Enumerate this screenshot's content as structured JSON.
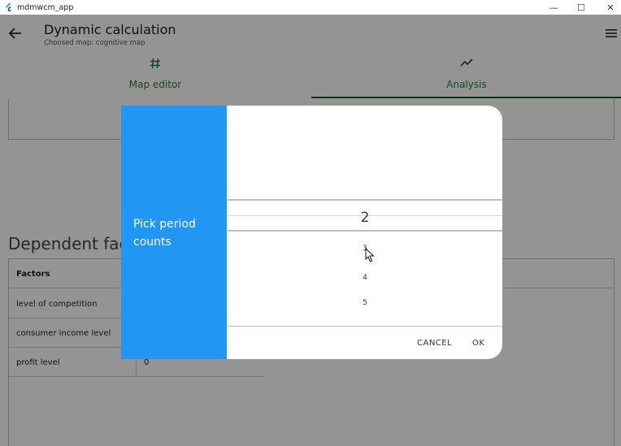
{
  "window": {
    "title": "mdmwcm_app",
    "minimize_glyph": "—",
    "maximize_glyph": "☐",
    "close_glyph": "✕"
  },
  "appbar": {
    "title": "Dynamic calculation",
    "subtitle": "Choosed map: cognitive map",
    "tabs": [
      {
        "label": "Map editor",
        "icon": "hash-icon"
      },
      {
        "label": "Analysis",
        "icon": "trending-icon"
      }
    ]
  },
  "section": {
    "title": "Dependent factors",
    "table_header": "Factors",
    "rows": [
      {
        "label": "level of competition",
        "value": ""
      },
      {
        "label": "consumer income level",
        "value": ""
      },
      {
        "label": "profit level",
        "value": "0"
      }
    ]
  },
  "dialog": {
    "title": "Pick period counts",
    "selected": "2",
    "options": [
      "3",
      "4",
      "5"
    ],
    "cancel_label": "CANCEL",
    "ok_label": "OK"
  },
  "colors": {
    "accent": "#2196f3",
    "tab_text": "#2e7d32",
    "tab_indicator": "#1b5e20"
  }
}
